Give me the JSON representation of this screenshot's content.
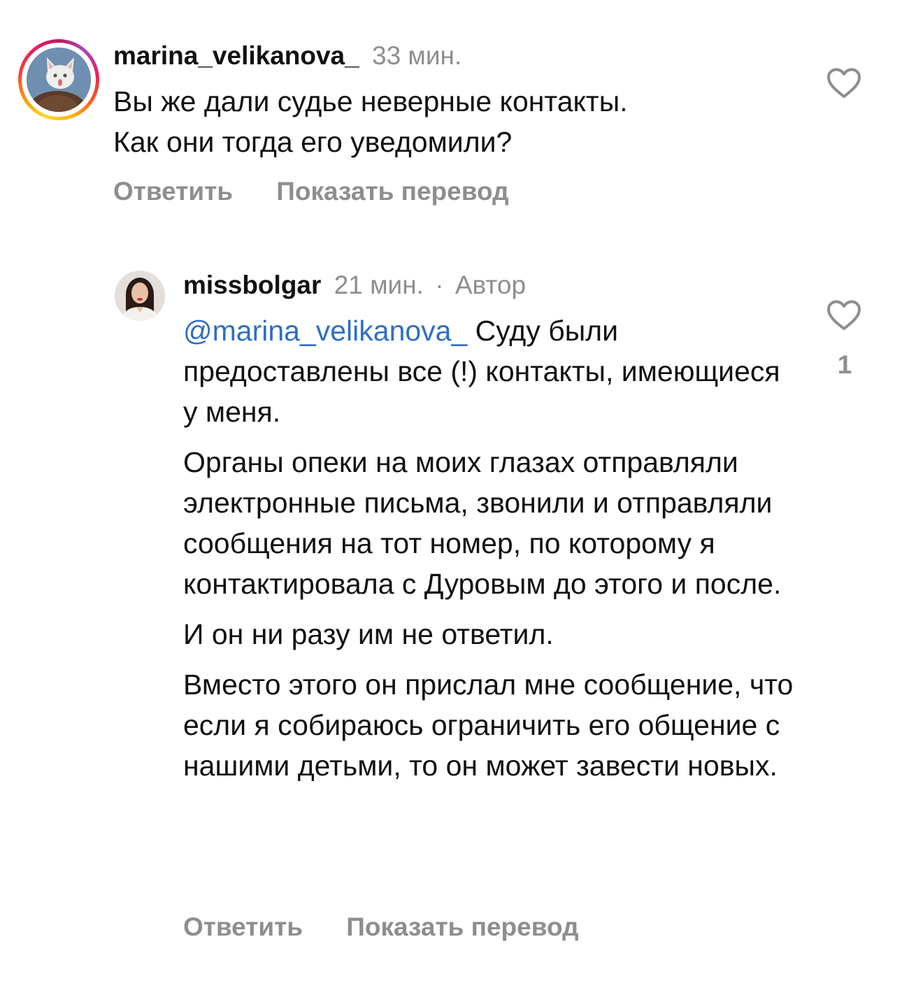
{
  "comments": [
    {
      "username": "marina_velikanova_",
      "time": "33 мин.",
      "text_lines": [
        "Вы же дали судье неверные контакты.",
        "Как они тогда его уведомили?"
      ],
      "reply_label": "Ответить",
      "translate_label": "Показать перевод",
      "avatar_icon": "cat-avatar-icon",
      "heart_icon": "heart-outline-icon"
    },
    {
      "username": "missbolgar",
      "time": "21 мин.",
      "separator": "·",
      "author_badge": "Автор",
      "mention": "@marina_velikanova_",
      "paragraph1_rest": " Суду были предоставлены все (!) контакты, имеющиеся у меня.",
      "paragraph2": "Органы опеки на моих глазах отправляли электронные письма, звонили и отправляли сообщения на тот номер, по которому я контактировала с Дуровым до этого и после.",
      "paragraph3": "И он ни разу им не ответил.",
      "paragraph4": "Вместо этого он прислал мне сообщение, что если я собираюсь ограничить его общение с нашими детьми, то он может завести новых.",
      "like_count": "1",
      "reply_label": "Ответить",
      "translate_label": "Показать перевод",
      "avatar_icon": "woman-portrait-avatar-icon",
      "heart_icon": "heart-outline-icon"
    }
  ],
  "colors": {
    "text": "#111111",
    "muted": "#8e8e8e",
    "mention": "#2f6fc4",
    "background": "#ffffff"
  }
}
